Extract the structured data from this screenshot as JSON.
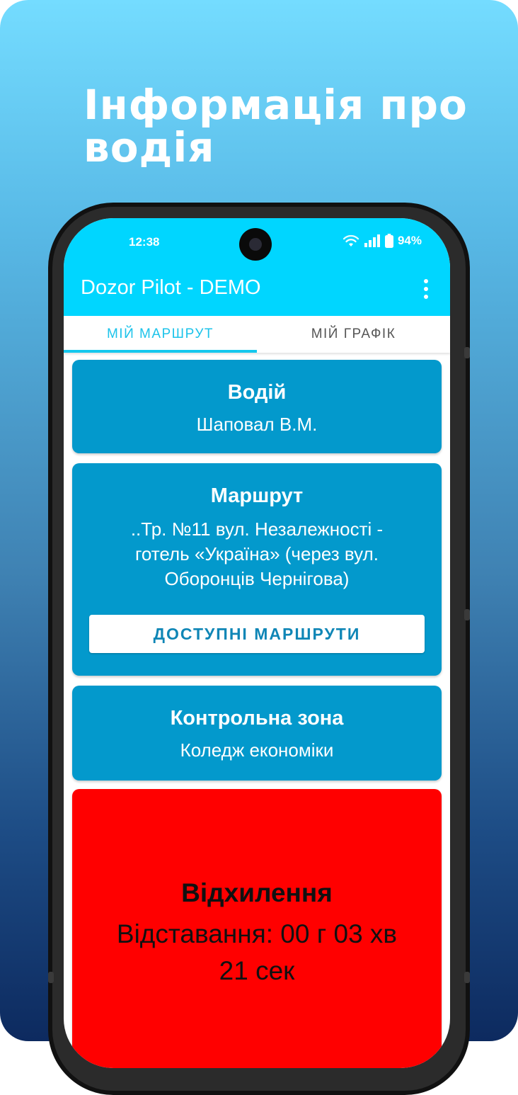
{
  "promo": {
    "headline": "Інформація про водія"
  },
  "status": {
    "time": "12:38",
    "battery": "94%"
  },
  "app": {
    "title": "Dozor Pilot - DEMO"
  },
  "tabs": [
    {
      "label": "МІЙ МАРШРУТ",
      "active": true
    },
    {
      "label": "МІЙ ГРАФІК",
      "active": false
    }
  ],
  "driver": {
    "title": "Водій",
    "name": "Шаповал В.М."
  },
  "route": {
    "title": "Маршрут",
    "lines": [
      "..Тр. №11 вул. Незалежності -",
      "готель «Україна» (через вул.",
      "Оборонців Чернігова)"
    ],
    "button_label": "ДОСТУПНІ МАРШРУТИ"
  },
  "control_zone": {
    "title": "Контрольна зона",
    "name": "Коледж економіки"
  },
  "deviation": {
    "title": "Відхилення",
    "line1": "Відставання:  00 г 03 хв",
    "line2": "21 сек"
  },
  "colors": {
    "appbar": "#00d6ff",
    "card": "#0399cc",
    "deviation": "#ff0000",
    "tab_active": "#1cc3ea"
  },
  "icons": [
    "wifi-icon",
    "signal-icon",
    "battery-icon",
    "more-vert-icon"
  ]
}
